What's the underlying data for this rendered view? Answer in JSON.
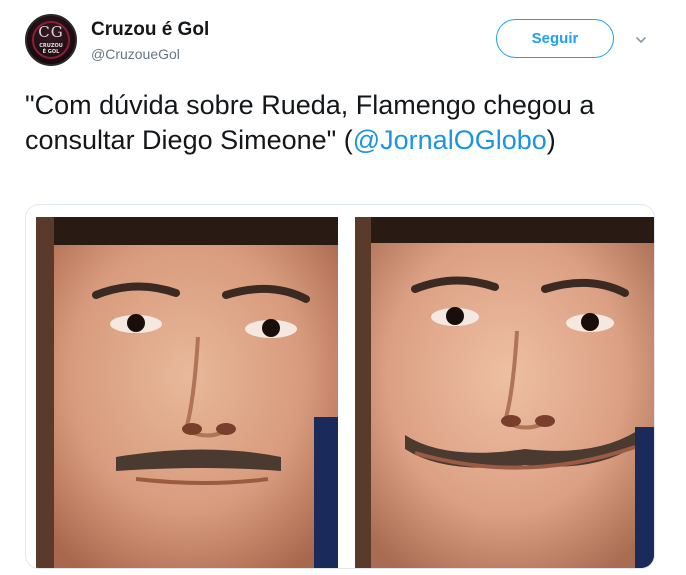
{
  "user": {
    "display_name": "Cruzou é Gol",
    "handle": "@CruzoueGol",
    "avatar_text": "CG",
    "avatar_subtext_line1": "CRUZOU",
    "avatar_subtext_line2": "É GOL"
  },
  "follow_button_label": "Seguir",
  "tweet": {
    "text_before": "\"Com dúvida sobre Rueda, Flamengo chegou a consultar Diego Simeone\" (",
    "mention": "@JornalOGlobo",
    "text_after": ")"
  },
  "colors": {
    "accent": "#1da1f2",
    "mention": "#1b95e0",
    "handle_gray": "#657786"
  },
  "icons": {
    "more_options": "chevron-down-icon"
  }
}
